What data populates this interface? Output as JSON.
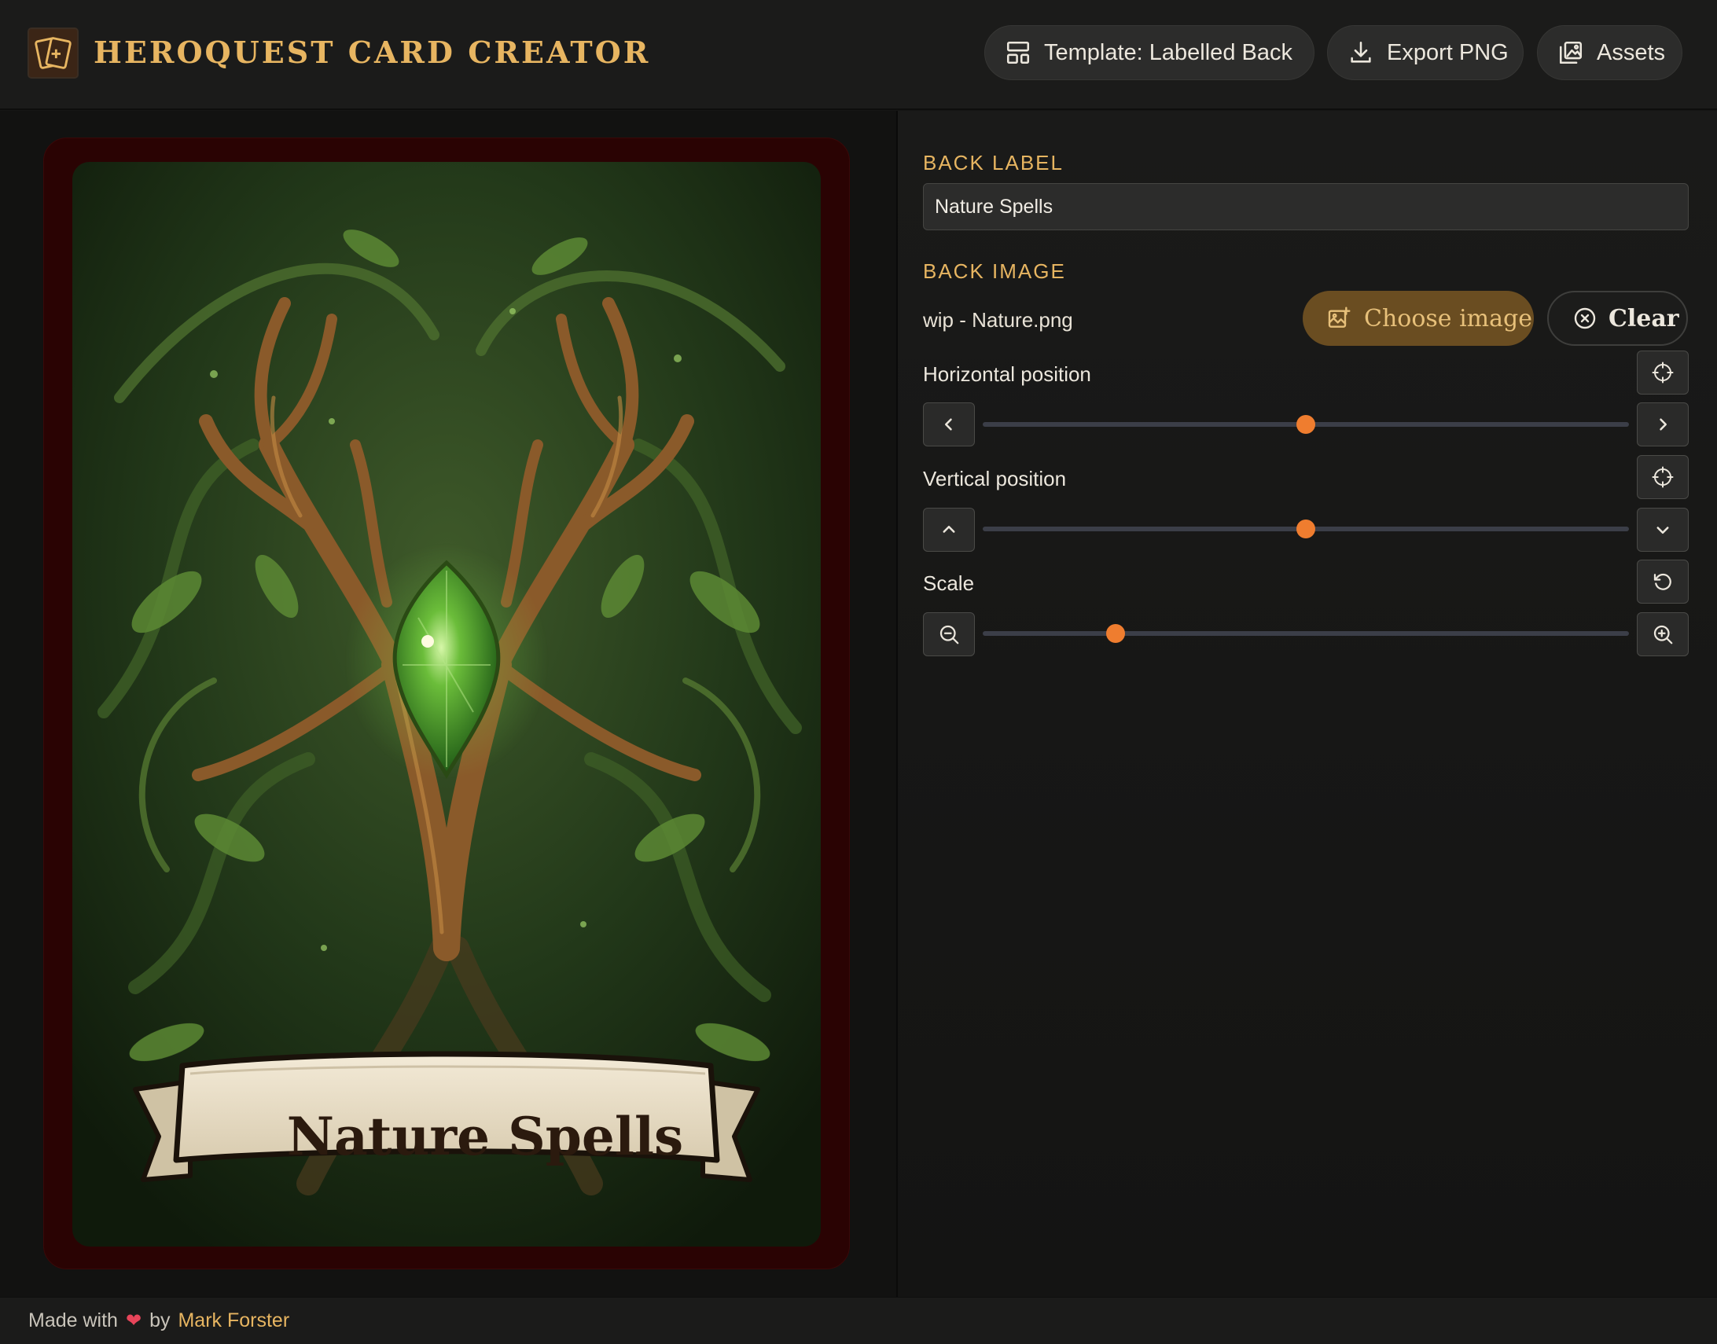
{
  "header": {
    "title": "HEROQUEST CARD CREATOR",
    "logo_icon": "card-deck-icon",
    "buttons": {
      "template": "Template: Labelled Back",
      "export": "Export PNG",
      "assets": "Assets"
    }
  },
  "card": {
    "label_text": "Nature Spells",
    "frame_color": "#2a0303",
    "art_description_icon": "nature-tree-gem-artwork"
  },
  "editor": {
    "back_label_heading": "BACK LABEL",
    "back_label_value": "Nature Spells",
    "back_image_heading": "BACK IMAGE",
    "image_filename": "wip - Nature.png",
    "choose_image": "Choose image",
    "clear": "Clear",
    "horizontal_label": "Horizontal position",
    "vertical_label": "Vertical position",
    "scale_label": "Scale",
    "horizontal_value": 0.5,
    "vertical_value": 0.5,
    "scale_value": 0.205
  },
  "footer": {
    "made_with": "Made with",
    "by": "by",
    "author": "Mark Forster"
  },
  "colors": {
    "accent": "#e7b561",
    "slider_thumb": "#ef7d2f",
    "choose_button": "#6a4d21"
  }
}
